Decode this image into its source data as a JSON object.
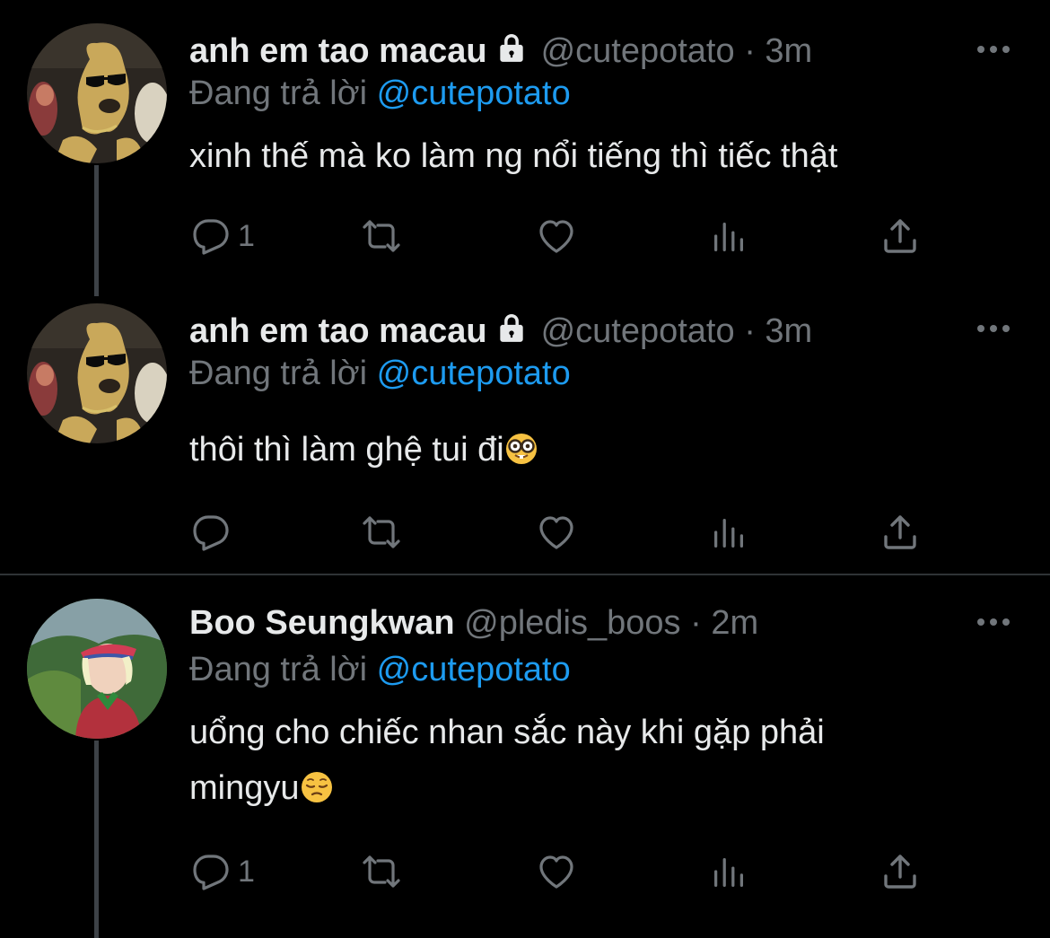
{
  "reply_prefix": "Đang trả lời",
  "colors": {
    "background": "#000000",
    "text": "#e7e9ea",
    "muted": "#71767b",
    "link": "#1d9bf0",
    "thread_line": "#3d4247",
    "divider": "#2f3336"
  },
  "tweets": [
    {
      "name": "anh em tao macau",
      "handle": "@cutepotato",
      "separator": "·",
      "time": "3m",
      "locked": true,
      "reply_to": "@cutepotato",
      "text": "xinh thế mà ko làm ng nổi tiếng thì tiếc thật",
      "reply_count": "1",
      "avatar": "dog-with-sunglasses-avatar"
    },
    {
      "name": "anh em tao macau",
      "handle": "@cutepotato",
      "separator": "·",
      "time": "3m",
      "locked": true,
      "reply_to": "@cutepotato",
      "text": "thôi thì làm ghệ tui đi",
      "text_emoji": "nerd-face-emoji",
      "reply_count": "",
      "avatar": "dog-with-sunglasses-avatar"
    },
    {
      "name": "Boo Seungkwan",
      "handle": "@pledis_boos",
      "separator": "·",
      "time": "2m",
      "locked": false,
      "reply_to": "@cutepotato",
      "text_line1": "uổng cho chiếc nhan sắc này khi gặp phải",
      "text_line2": "mingyu",
      "text_emoji": "pensive-face-emoji",
      "reply_count": "1",
      "avatar": "person-with-visor-avatar"
    }
  ]
}
